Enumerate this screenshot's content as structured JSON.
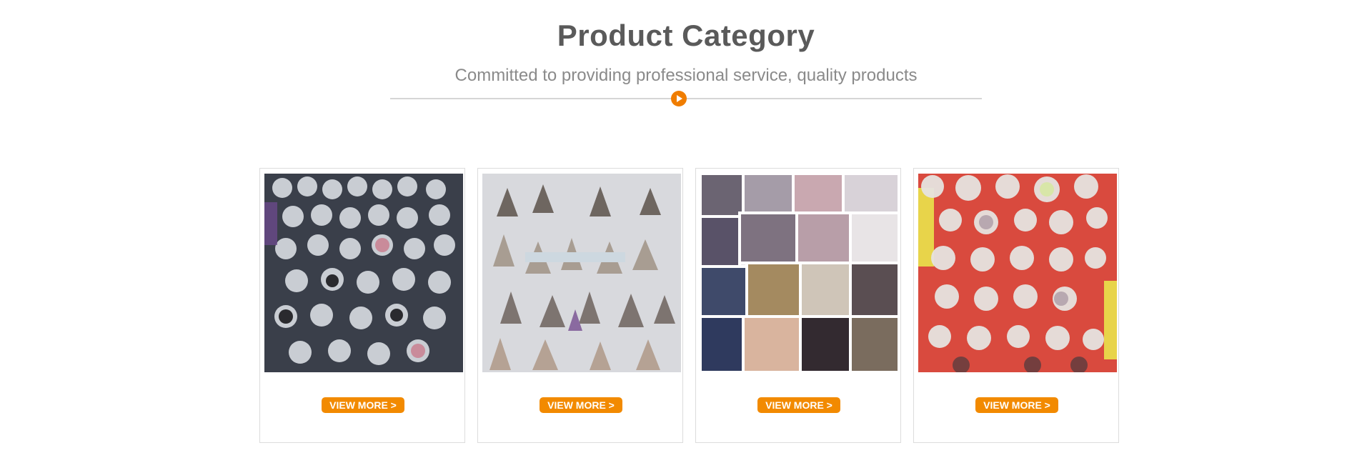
{
  "section": {
    "title": "Product Category",
    "subtitle": "Committed to providing professional service, quality products",
    "accent_color": "#f07d00",
    "divider_icon": "play-circle-icon"
  },
  "cards": [
    {
      "image": "crystal-skulls-photo",
      "button_label": "VIEW MORE >"
    },
    {
      "image": "crystal-points-photo",
      "button_label": "VIEW MORE >"
    },
    {
      "image": "bracelets-trays-photo",
      "button_label": "VIEW MORE >"
    },
    {
      "image": "crystal-spheres-photo",
      "button_label": "VIEW MORE >"
    }
  ],
  "button_color": "#f28a00"
}
